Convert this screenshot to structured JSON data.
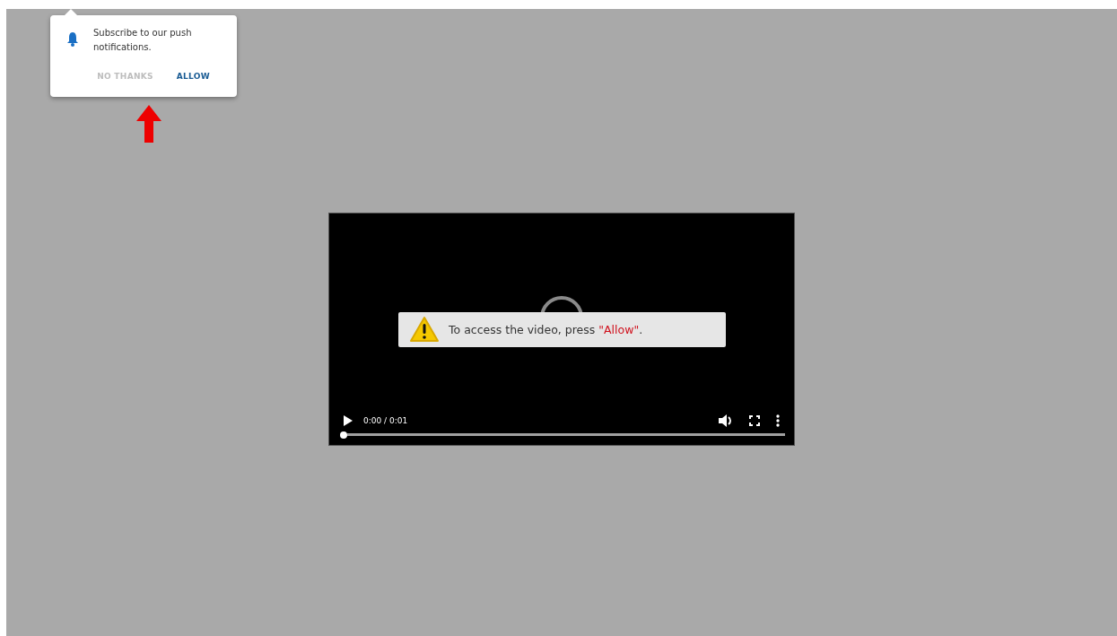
{
  "notification_popup": {
    "message": "Subscribe to our push notifications.",
    "buttons": [
      {
        "kind": "dismiss",
        "label": "NO THANKS"
      },
      {
        "kind": "confirm",
        "label": "ALLOW"
      }
    ]
  },
  "video_player": {
    "notice": {
      "text": "To access the video, press ",
      "highlight": "\"Allow\"",
      "suffix": "."
    },
    "time": "0:00 / 0:01",
    "progress": {
      "level": 0
    }
  }
}
